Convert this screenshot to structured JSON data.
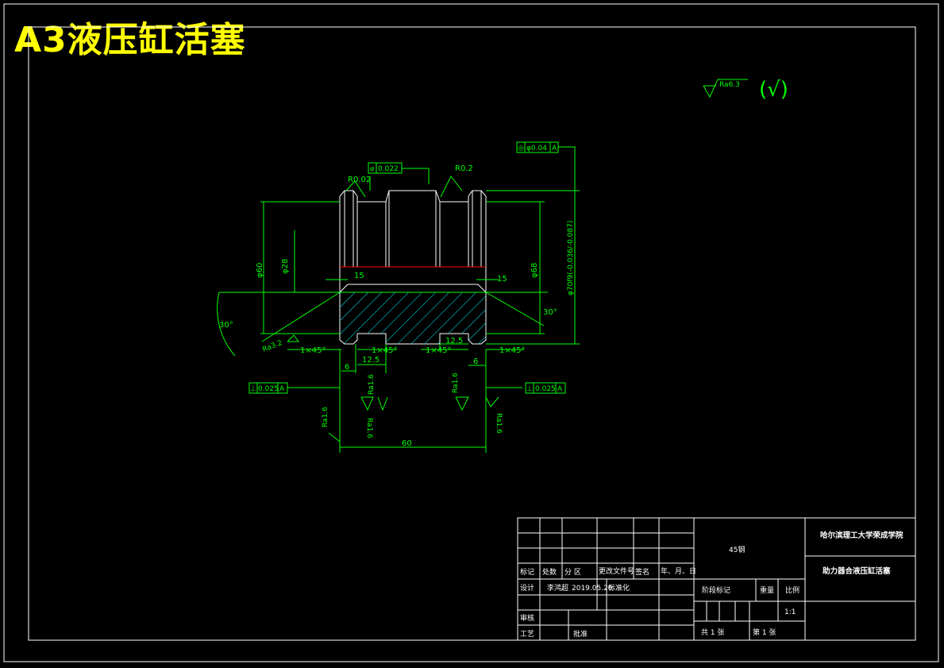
{
  "banner": {
    "title": "A3液压缸活塞"
  },
  "surface_finish": {
    "general_symbol": "Ra6.3",
    "bracket_symbol": "(√)"
  },
  "dimensions": {
    "d60": "φ60",
    "d28": "φ28",
    "d68": "φ68",
    "d70": "φ70f9(-0.036/-0.087)",
    "l15_left": "15",
    "l15_right": "15",
    "ang30_left": "30°",
    "ang30_right": "30°",
    "r002": "R0.02",
    "r02": "R0.2",
    "c1_a": "1×45°",
    "c1_b": "1×45°",
    "c1_c": "1×45°",
    "c1_d": "1×45°",
    "l6_left": "6",
    "l6_right": "6",
    "l125_left": "12.5",
    "l125_right": "12.5",
    "l60": "60",
    "ra32": "Ra3.2",
    "ra16_a": "Ra1.6",
    "ra16_b": "Ra1.6",
    "ra16_c": "Ra1.6",
    "ra16_d": "Ra1.6",
    "ra16_e": "Ra1.6"
  },
  "tolerances": {
    "top_center": {
      "symbol": "⌀",
      "value": "0.022"
    },
    "top_right": {
      "symbol": "◎",
      "value": "φ0.04",
      "datum": "A"
    },
    "left": {
      "symbol": "⊥",
      "value": "0.025",
      "datum": "A"
    },
    "right": {
      "symbol": "⊥",
      "value": "0.025",
      "datum": "A"
    }
  },
  "title_block": {
    "material": "45钢",
    "school": "哈尔滨理工大学荣成学院",
    "part_name": "助力器合液压缸活塞",
    "rev_headers": [
      "标记",
      "处数",
      "分  区",
      "更改文件号",
      "签名",
      "年、月、日"
    ],
    "design_label": "设计",
    "designer": "李鸿超",
    "date": "2019.05.20",
    "standardize_label": "标准化",
    "review_label": "审核",
    "process_label": "工艺",
    "approve_label": "批准",
    "stage_label": "阶段标记",
    "weight_label": "重量",
    "scale_label": "比例",
    "scale_value": "1:1",
    "sheets_total_label": "共  1  张",
    "sheet_no_label": "第  1  张"
  }
}
